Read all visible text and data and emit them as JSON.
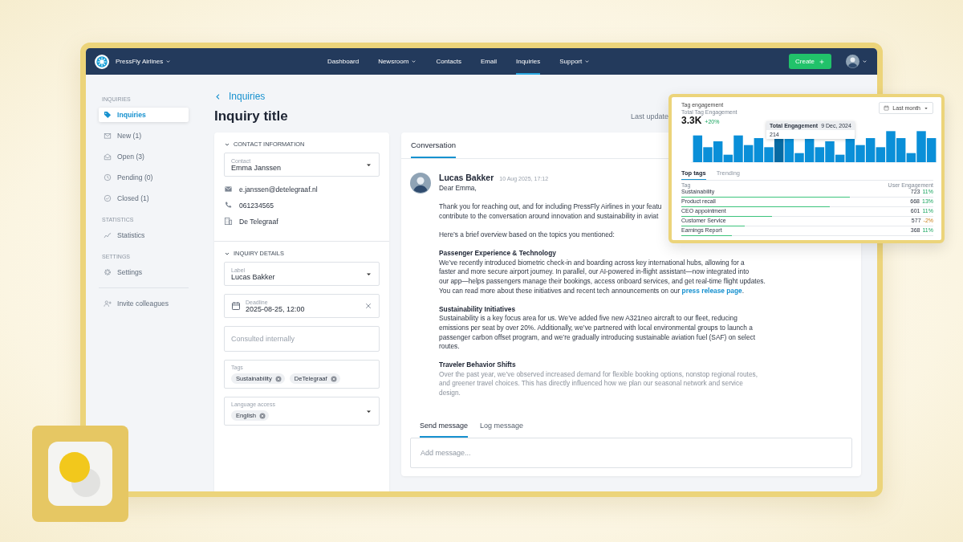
{
  "brand": {
    "name": "PressFly Airlines"
  },
  "nav": [
    {
      "label": "Dashboard",
      "dropdown": false,
      "selected": false
    },
    {
      "label": "Newsroom",
      "dropdown": true,
      "selected": false
    },
    {
      "label": "Contacts",
      "dropdown": false,
      "selected": false
    },
    {
      "label": "Email",
      "dropdown": false,
      "selected": false
    },
    {
      "label": "Inquiries",
      "dropdown": false,
      "selected": true
    },
    {
      "label": "Support",
      "dropdown": true,
      "selected": false
    }
  ],
  "create_button": "Create",
  "sidebar": {
    "sections": [
      {
        "heading": "INQUIRIES",
        "items": [
          {
            "label": "Inquiries",
            "selected": true
          },
          {
            "label": "New (1)",
            "selected": false
          },
          {
            "label": "Open (3)",
            "selected": false
          },
          {
            "label": "Pending (0)",
            "selected": false
          },
          {
            "label": "Closed (1)",
            "selected": false
          }
        ]
      },
      {
        "heading": "STATISTICS",
        "items": [
          {
            "label": "Statistics",
            "selected": false
          }
        ]
      },
      {
        "heading": "SETTINGS",
        "items": [
          {
            "label": "Settings",
            "selected": false
          }
        ]
      }
    ],
    "footer": "Invite colleagues"
  },
  "breadcrumb": "Inquiries",
  "title": "Inquiry title",
  "last_update": "Last update",
  "contact_section": {
    "heading": "CONTACT INFORMATION",
    "expanded": true,
    "contact": {
      "label": "Contact",
      "value": "Emma Janssen"
    },
    "details": [
      "e.janssen@detelegraaf.nl",
      "061234565",
      "De Telegraaf"
    ]
  },
  "inquiry_section": {
    "heading": "INQUIRY DETAILS",
    "expanded": true,
    "fields": [
      {
        "kind": "select",
        "label": "Label",
        "value": "Lucas Bakker"
      },
      {
        "kind": "date",
        "label": "Deadline",
        "value": "2025-08-25, 12:00"
      },
      {
        "kind": "text",
        "placeholder": "Consulted internally"
      },
      {
        "kind": "chips",
        "label": "Tags",
        "chips": [
          "Sustainability",
          "DeTelegraaf"
        ]
      },
      {
        "kind": "chips-select",
        "label": "Language access",
        "chips": [
          "English"
        ]
      }
    ]
  },
  "conversation": {
    "tabs": [
      {
        "label": "Conversation",
        "selected": true
      }
    ],
    "message": {
      "author": "Lucas Bakker",
      "time": "10 Aug 2025, 17:12",
      "greeting": "Dear Emma,",
      "paragraphs": [
        {
          "text": "Thank you for reaching out, and for including PressFly Airlines in your featu\ncontribute to the conversation around innovation and sustainability in aviat",
          "faded": false
        },
        {
          "text": "Here’s a brief overview based on the topics you mentioned:",
          "faded": false
        },
        {
          "heading": "Passenger Experience & Technology",
          "text": "We’ve recently introduced biometric check-in and boarding across key international hubs, allowing for a\nfaster and more secure airport journey. In parallel, our AI-powered in-flight assistant—now integrated into\nour app—helps passengers manage their bookings, access onboard services, and get real-time flight updates.\nYou can read more about these initiatives and recent tech announcements on our",
          "link": "press release page",
          "after": ".",
          "faded": false
        },
        {
          "heading": "Sustainability Initiatives",
          "text": "Sustainability is a key focus area for us. We’ve added five new A321neo aircraft to our fleet, reducing\nemissions per seat by over 20%. Additionally, we’ve partnered with local environmental groups to launch a\npassenger carbon offset program, and we’re gradually introducing sustainable aviation fuel (SAF) on select\nroutes.",
          "faded": false
        },
        {
          "heading": "Traveler Behavior Shifts",
          "text": "Over the past year, we’ve observed increased demand for flexible booking options, nonstop regional routes,\nand greener travel choices. This has directly influenced how we plan our seasonal network and service\ndesign.",
          "faded": true
        }
      ]
    },
    "compose_tabs": [
      {
        "label": "Send message",
        "selected": true
      },
      {
        "label": "Log message",
        "selected": false
      }
    ],
    "compose": {
      "placeholder": "Add message..."
    }
  },
  "engagement": {
    "title": "Tag engagement",
    "period": "Last month",
    "total_label": "Total Tag Engagement",
    "total": "3.3K",
    "change": "+20%",
    "tooltip": {
      "title": "Total Engagement",
      "date": "9 Dec, 2024",
      "value": "214"
    },
    "tabs": [
      {
        "label": "Top tags",
        "selected": true
      },
      {
        "label": "Trending",
        "selected": false
      }
    ],
    "columns": [
      "Tag",
      "User Engagement"
    ],
    "rows": [
      {
        "tag": "Sustainability",
        "value": "723",
        "change": "11%",
        "rising": true,
        "level": 0.67
      },
      {
        "tag": "Product recall",
        "value": "668",
        "change": "13%",
        "rising": true,
        "level": 0.59
      },
      {
        "tag": "CEO appointment",
        "value": "601",
        "change": "11%",
        "rising": true,
        "level": 0.36
      },
      {
        "tag": "Customer Service",
        "value": "577",
        "change": "-2%",
        "rising": false,
        "level": 0.25
      },
      {
        "tag": "Earnings Report",
        "value": "368",
        "change": "11%",
        "rising": true,
        "level": 0.2
      }
    ]
  }
}
